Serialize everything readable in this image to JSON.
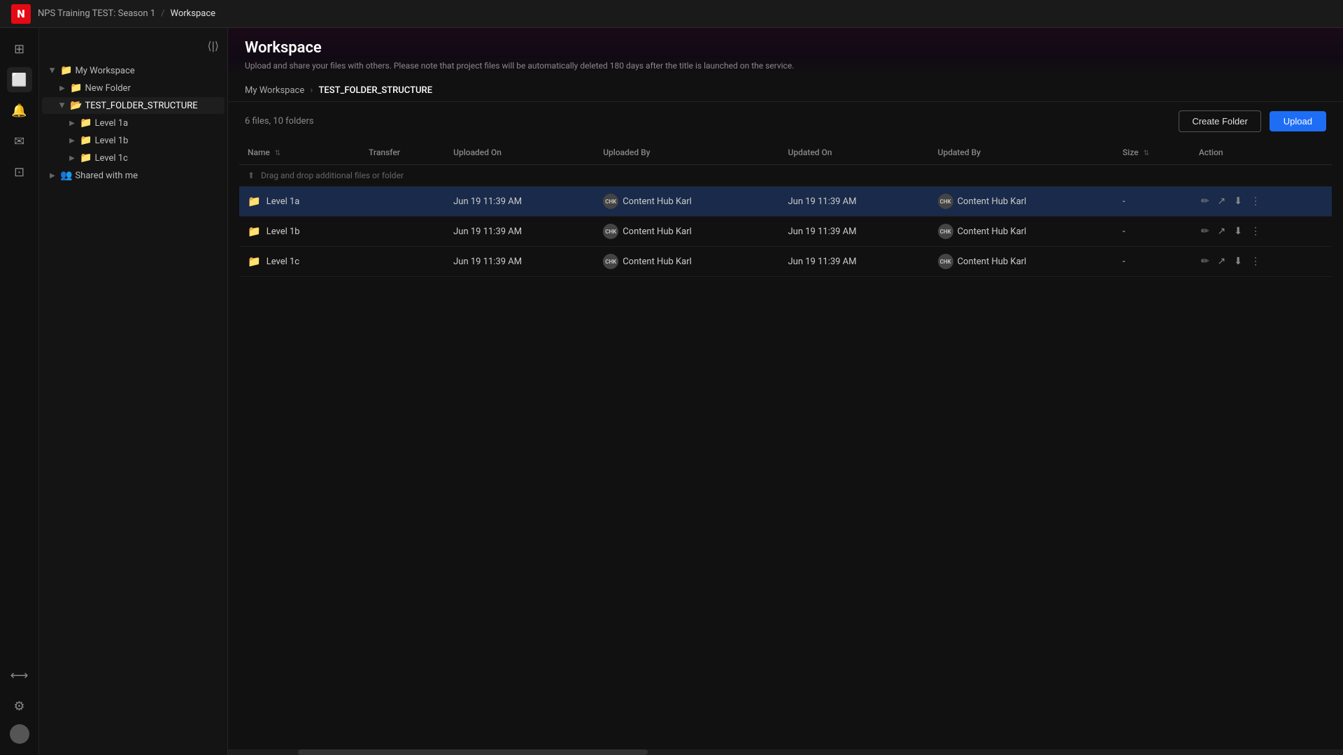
{
  "topbar": {
    "logo": "N",
    "breadcrumb_parent": "NPS Training TEST: Season 1",
    "breadcrumb_sep": "/",
    "breadcrumb_current": "Workspace"
  },
  "page": {
    "title": "Workspace",
    "subtitle": "Upload and share your files with others. Please note that project files will be automatically deleted 180 days after the title is launched on the service."
  },
  "breadcrumb_nav": {
    "parent": "My Workspace",
    "current": "TEST_FOLDER_STRUCTURE"
  },
  "toolbar": {
    "file_count": "6 files, 10 folders",
    "create_folder_label": "Create Folder",
    "upload_label": "Upload"
  },
  "table": {
    "columns": {
      "name": "Name",
      "transfer": "Transfer",
      "uploaded_on": "Uploaded On",
      "uploaded_by": "Uploaded By",
      "updated_on": "Updated On",
      "updated_by": "Updated By",
      "size": "Size",
      "action": "Action"
    },
    "drag_drop_label": "Drag and drop additional files or folder",
    "rows": [
      {
        "id": "row-1a",
        "name": "Level 1a",
        "transfer": "",
        "uploaded_on": "Jun 19 11:39 AM",
        "uploaded_by": "Content Hub Karl",
        "updated_on": "Jun 19 11:39 AM",
        "updated_by": "Content Hub Karl",
        "size": "-",
        "highlighted": true
      },
      {
        "id": "row-1b",
        "name": "Level 1b",
        "transfer": "",
        "uploaded_on": "Jun 19 11:39 AM",
        "uploaded_by": "Content Hub Karl",
        "updated_on": "Jun 19 11:39 AM",
        "updated_by": "Content Hub Karl",
        "size": "-",
        "highlighted": false
      },
      {
        "id": "row-1c",
        "name": "Level 1c",
        "transfer": "",
        "uploaded_on": "Jun 19 11:39 AM",
        "uploaded_by": "Content Hub Karl",
        "updated_on": "Jun 19 11:39 AM",
        "updated_by": "Content Hub Karl",
        "size": "-",
        "highlighted": false
      }
    ]
  },
  "sidebar": {
    "my_workspace_label": "My Workspace",
    "new_folder_label": "New Folder",
    "test_folder_label": "TEST_FOLDER_STRUCTURE",
    "level1a_label": "Level 1a",
    "level1b_label": "Level 1b",
    "level1c_label": "Level 1c",
    "shared_with_me_label": "Shared with me"
  },
  "icons": {
    "collapse": "⟨⟩",
    "folder": "📁",
    "folder_open": "📂",
    "arrow_right": "▶",
    "upload_arrow": "⬆",
    "pencil": "✏",
    "share": "↗",
    "download": "⬇",
    "more": "⋮",
    "chk_avatar": "CHK"
  }
}
